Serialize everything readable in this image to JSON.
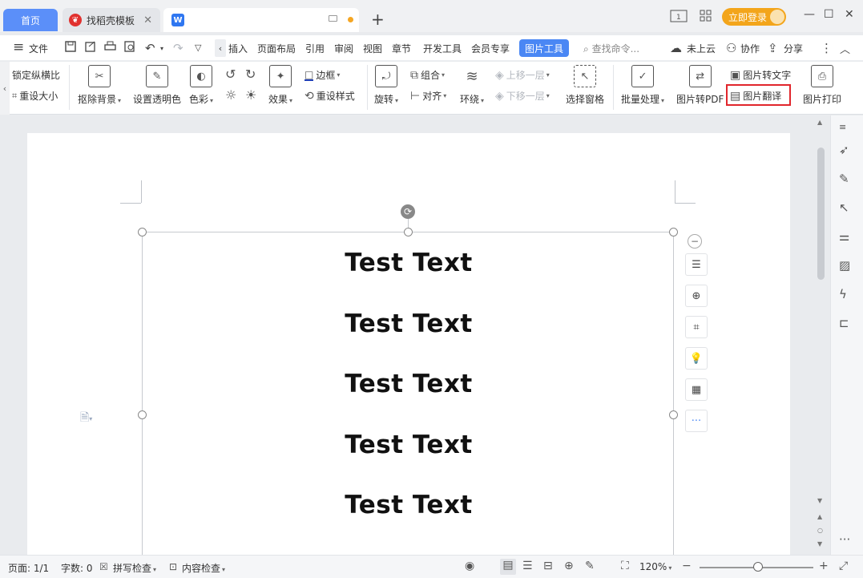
{
  "tabs": {
    "home": "首页",
    "templates": "找稻壳模板",
    "doc_logo": "W",
    "close_glyph": "✕",
    "new_tab_glyph": "+"
  },
  "titlebar": {
    "login_label": "立即登录",
    "window_buttons": [
      "—",
      "☐",
      "✕"
    ]
  },
  "menu": {
    "hamburger_glyph": "≡",
    "file": "文件",
    "items": [
      "插入",
      "页面布局",
      "引用",
      "审阅",
      "视图",
      "章节",
      "开发工具",
      "会员专享"
    ],
    "active_tab": "图片工具",
    "search_placeholder": "查找命令...",
    "cloud": "未上云",
    "collab": "协作",
    "share": "分享"
  },
  "ribbon": {
    "lock_ratio": "锁定纵横比",
    "reset_size": "重设大小",
    "remove_bg": "抠除背景",
    "set_transparent": "设置透明色",
    "color": "色彩",
    "effects": "效果",
    "border": "边框",
    "reset_style": "重设样式",
    "rotate": "旋转",
    "group": "组合",
    "align": "对齐",
    "wrap": "环绕",
    "bring_forward": "上移一层",
    "send_backward": "下移一层",
    "selection_pane": "选择窗格",
    "batch": "批量处理",
    "to_pdf": "图片转PDF",
    "to_text": "图片转文字",
    "translate": "图片翻译",
    "print": "图片打印"
  },
  "document": {
    "lines": [
      "Test Text",
      "Test Text",
      "Test Text",
      "Test Text",
      "Test Text"
    ]
  },
  "statusbar": {
    "page": "页面: 1/1",
    "words": "字数: 0",
    "spell": "拼写检查",
    "content_check": "内容检查",
    "zoom": "120%"
  },
  "colors": {
    "accent": "#4a87f4",
    "home_tab": "#5b8ff9",
    "login": "#f3a51b",
    "highlight": "#e1262c"
  }
}
